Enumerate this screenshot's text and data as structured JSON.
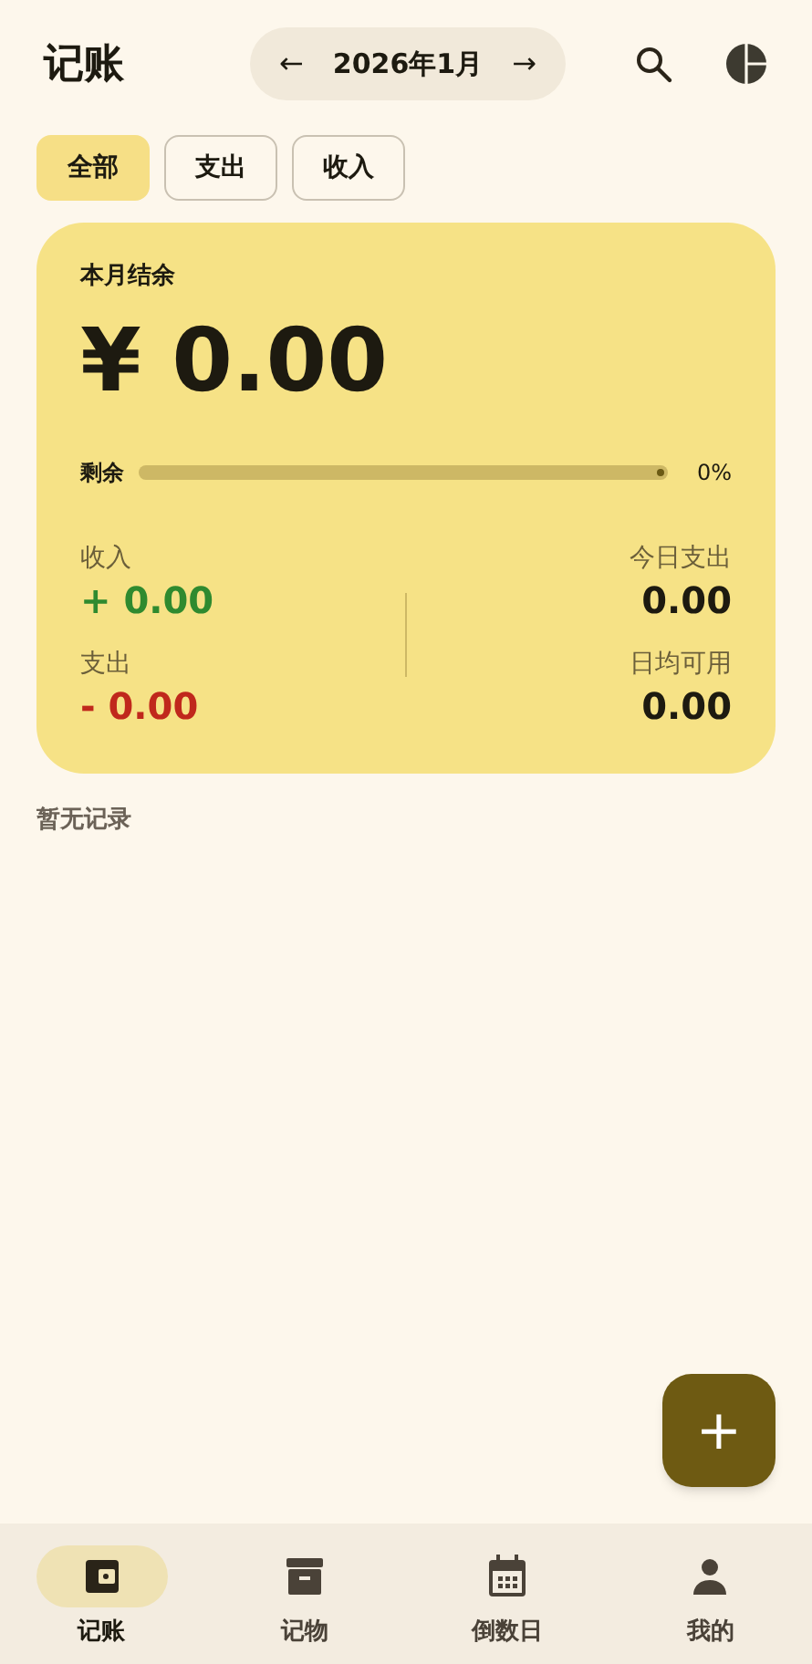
{
  "header": {
    "title": "记账",
    "month": {
      "prev": "←",
      "label": "2026年1月",
      "next": "→"
    }
  },
  "filters": [
    {
      "label": "全部",
      "selected": true
    },
    {
      "label": "支出",
      "selected": false
    },
    {
      "label": "收入",
      "selected": false
    }
  ],
  "summary": {
    "title": "本月结余",
    "balance": "¥ 0.00",
    "remaining": {
      "label": "剩余",
      "level": 0,
      "reading": "0%"
    },
    "stats": [
      {
        "label": "收入",
        "value": "+ 0.00",
        "kind": "income"
      },
      {
        "label": "支出",
        "value": "- 0.00",
        "kind": "expense"
      },
      {
        "label": "今日支出",
        "value": "0.00",
        "kind": "neutral"
      },
      {
        "label": "日均可用",
        "value": "0.00",
        "kind": "neutral"
      }
    ]
  },
  "empty_message": "暂无记录",
  "fab": {
    "label": "+"
  },
  "nav": [
    {
      "label": "记账",
      "selected": true
    },
    {
      "label": "记物",
      "selected": false
    },
    {
      "label": "倒数日",
      "selected": false
    },
    {
      "label": "我的",
      "selected": false
    }
  ]
}
